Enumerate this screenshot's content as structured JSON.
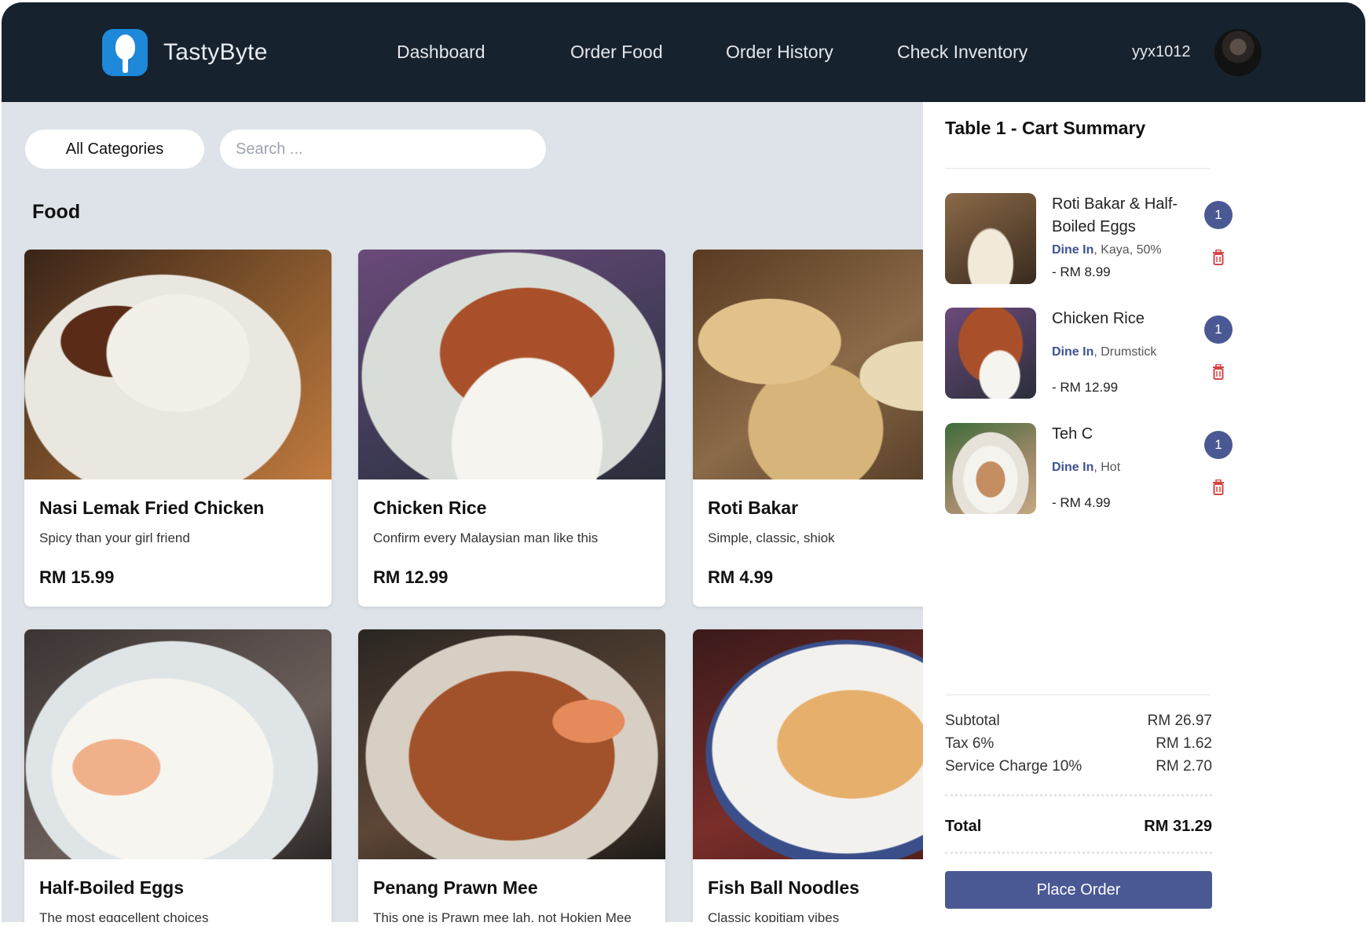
{
  "brand": {
    "name": "TastyByte",
    "logo_icon": "spoon-icon",
    "accent": "#1e88d9"
  },
  "nav": {
    "links": [
      "Dashboard",
      "Order Food",
      "Order History",
      "Check Inventory"
    ],
    "username": "yyx1012"
  },
  "toolbar": {
    "category_label": "All Categories",
    "search_placeholder": "Search ...",
    "search_value": ""
  },
  "section_title": "Food",
  "menu_items": [
    {
      "name": "Nasi Lemak Fried Chicken",
      "desc": "Spicy than your girl friend",
      "price": "RM 15.99"
    },
    {
      "name": "Chicken Rice",
      "desc": "Confirm every Malaysian man like this",
      "price": "RM 12.99"
    },
    {
      "name": "Roti Bakar",
      "desc": "Simple, classic, shiok",
      "price": "RM 4.99"
    },
    {
      "name": "Half-Boiled Eggs",
      "desc": "The most eggcellent choices",
      "price": ""
    },
    {
      "name": "Penang Prawn Mee",
      "desc": "This one is Prawn mee lah, not Hokien Mee",
      "price": ""
    },
    {
      "name": "Fish Ball Noodles",
      "desc": "Classic kopitiam vibes",
      "price": ""
    }
  ],
  "cart": {
    "title": "Table 1 - Cart Summary",
    "items": [
      {
        "name": "Roti Bakar & Half-Boiled Eggs",
        "mode": "Dine In",
        "options": ", Kaya, 50%",
        "price": "- RM 8.99",
        "qty": "1"
      },
      {
        "name": "Chicken Rice",
        "mode": "Dine In",
        "options": ", Drumstick",
        "price": "- RM 12.99",
        "qty": "1"
      },
      {
        "name": "Teh C",
        "mode": "Dine In",
        "options": ", Hot",
        "price": "- RM 4.99",
        "qty": "1"
      }
    ],
    "subtotal_label": "Subtotal",
    "subtotal": "RM 26.97",
    "tax_label": "Tax 6%",
    "tax": "RM 1.62",
    "service_label": "Service Charge 10%",
    "service": "RM 2.70",
    "total_label": "Total",
    "total": "RM 31.29",
    "place_order": "Place Order"
  },
  "colors": {
    "header_bg": "#16222e",
    "page_bg": "#dde3e8",
    "primary": "#4a5894",
    "delete": "#d64545"
  }
}
